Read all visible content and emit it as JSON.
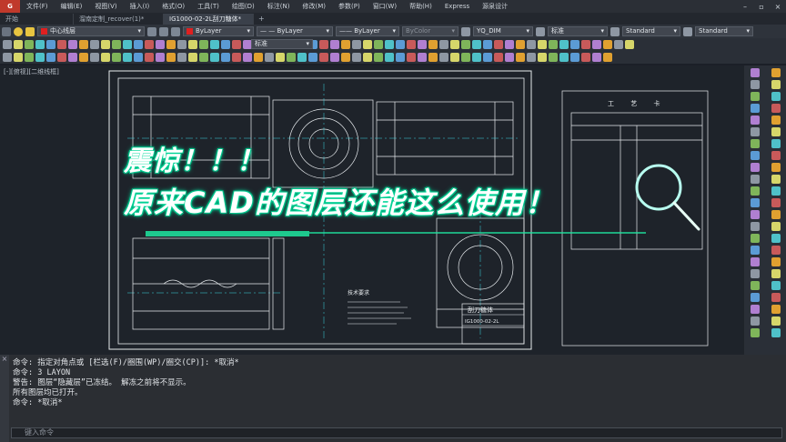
{
  "menubar": {
    "app_logo": "G",
    "items": [
      "文件(F)",
      "编辑(E)",
      "视图(V)",
      "插入(I)",
      "格式(O)",
      "工具(T)",
      "绘图(D)",
      "标注(N)",
      "修改(M)",
      "参数(P)",
      "窗口(W)",
      "帮助(H)",
      "Express",
      "源泉设计"
    ]
  },
  "tabs": [
    "开始",
    "溜南定制_recover(1)*",
    "IG1000-02-2L刮刀糖体*"
  ],
  "properties": {
    "layer": "中心线层",
    "color": "ByLayer",
    "color_hex": "#e02020",
    "linetype": "ByLayer",
    "lineweight": "ByLayer",
    "plotstyle": "ByColor",
    "dimstyle": "YQ_DIM",
    "textstyle": "标准",
    "tablestyle": "Standard",
    "mleaderstyle": "Standard",
    "second_dropdown": "标准"
  },
  "viewport": {
    "label": "[-][俯视][二维线框]"
  },
  "title_block": {
    "name": "刮刀糖体",
    "code": "IG1000-02-2L"
  },
  "notes_title": "技术要求",
  "table_title": "工 艺 卡",
  "overlay": {
    "line1": "震惊！！！",
    "line2": "原来CAD的图层还能这么使用！"
  },
  "command": {
    "lines": [
      "命令: 指定对角点或 [栏选(F)/圈围(WP)/圈交(CP)]: *取消*",
      "命令: 3 LAYON",
      "警告: 图层“隐藏层”已冻结。 解冻之前将不显示。",
      "所有图层均已打开。",
      "命令: *取消*"
    ],
    "placeholder": "键入命令"
  },
  "colors": {
    "accent_green": "#1ee6a0",
    "drawing_line": "#e8ecef",
    "cyan_line": "#3ad7e0"
  }
}
